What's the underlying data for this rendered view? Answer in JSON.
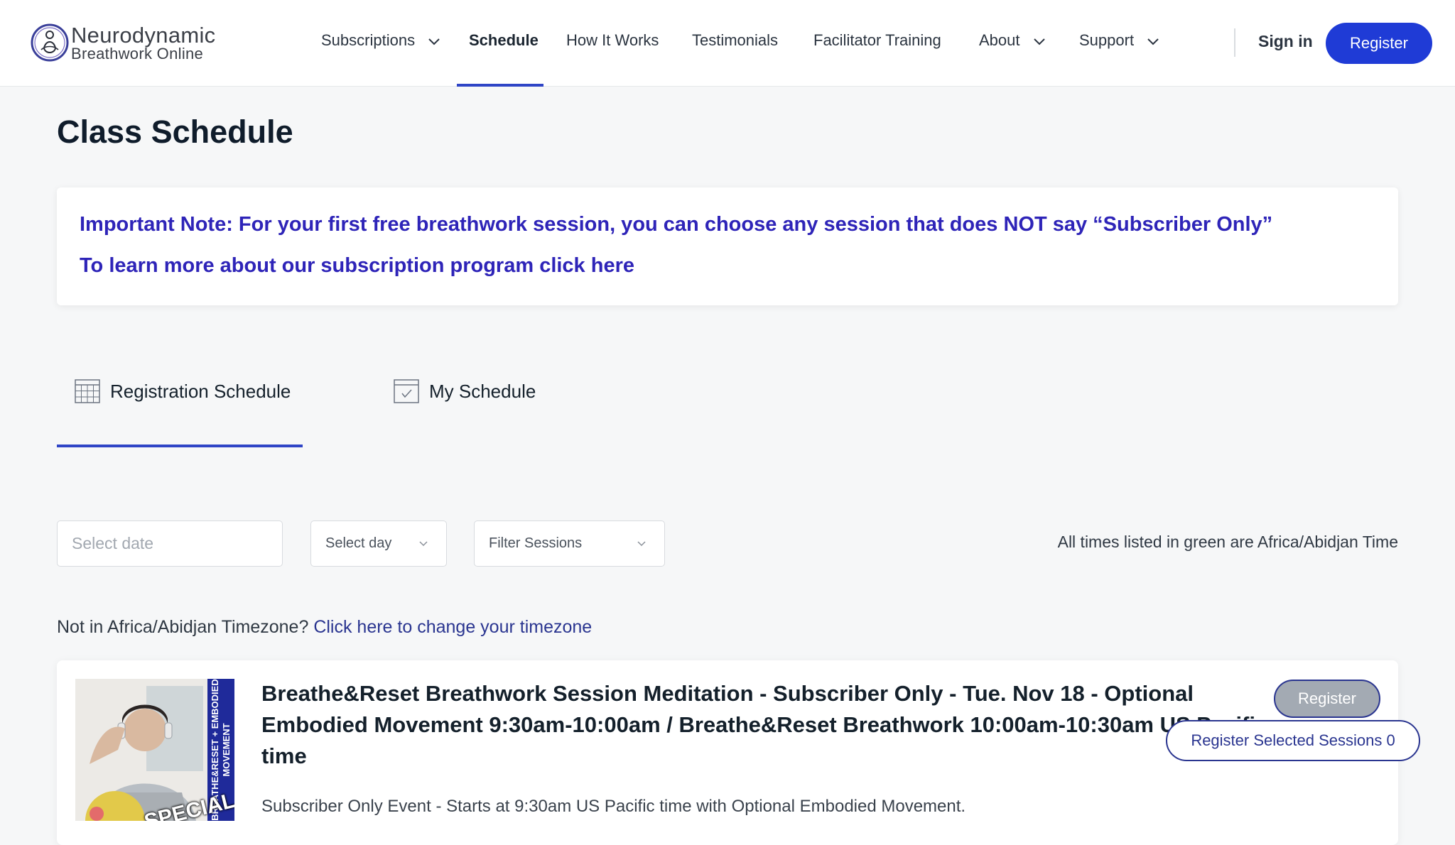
{
  "logo": {
    "line1": "Neurodynamic",
    "line2": "Breathwork Online"
  },
  "nav": {
    "items": [
      {
        "label": "Subscriptions",
        "dropdown": true
      },
      {
        "label": "Schedule",
        "active": true
      },
      {
        "label": "How It Works"
      },
      {
        "label": "Testimonials"
      },
      {
        "label": "Facilitator Training"
      },
      {
        "label": "About",
        "dropdown": true
      },
      {
        "label": "Support",
        "dropdown": true
      }
    ],
    "sign_in": "Sign in",
    "register": "Register"
  },
  "page": {
    "title": "Class Schedule"
  },
  "note": {
    "line1": "Important Note: For your first free breathwork session, you can choose any session that does NOT say “Subscriber Only”",
    "line2": "To learn more about our subscription program click here"
  },
  "tabs": [
    {
      "label": "Registration Schedule",
      "icon": "calendar-grid-icon",
      "active": true
    },
    {
      "label": "My Schedule",
      "icon": "calendar-check-icon"
    }
  ],
  "filters": {
    "date_placeholder": "Select date",
    "day_label": "Select day",
    "sessions_label": "Filter Sessions"
  },
  "timezone": {
    "note": "All times listed in green are Africa/Abidjan Time",
    "prompt": "Not in Africa/Abidjan Timezone? ",
    "link": "Click here to change your timezone"
  },
  "session": {
    "title": "Breathe&Reset Breathwork Session Meditation - Subscriber Only - Tue. Nov 18 - Optional Embodied Movement 9:30am-10:00am / Breathe&Reset Breathwork 10:00am-10:30am US Pacific time",
    "description": "Subscriber Only Event - Starts at 9:30am US Pacific time with Optional Embodied Movement.",
    "register_label": "Register",
    "thumbnail_text": {
      "banner": "BREATHE&RESET + EMBODIED MOVEMENT",
      "badge": "SPECIAL"
    }
  },
  "floating": {
    "label": "Register Selected Sessions 0"
  },
  "colors": {
    "accent": "#1f3bd6",
    "note_text": "#2e24b8",
    "link": "#2a3590"
  }
}
